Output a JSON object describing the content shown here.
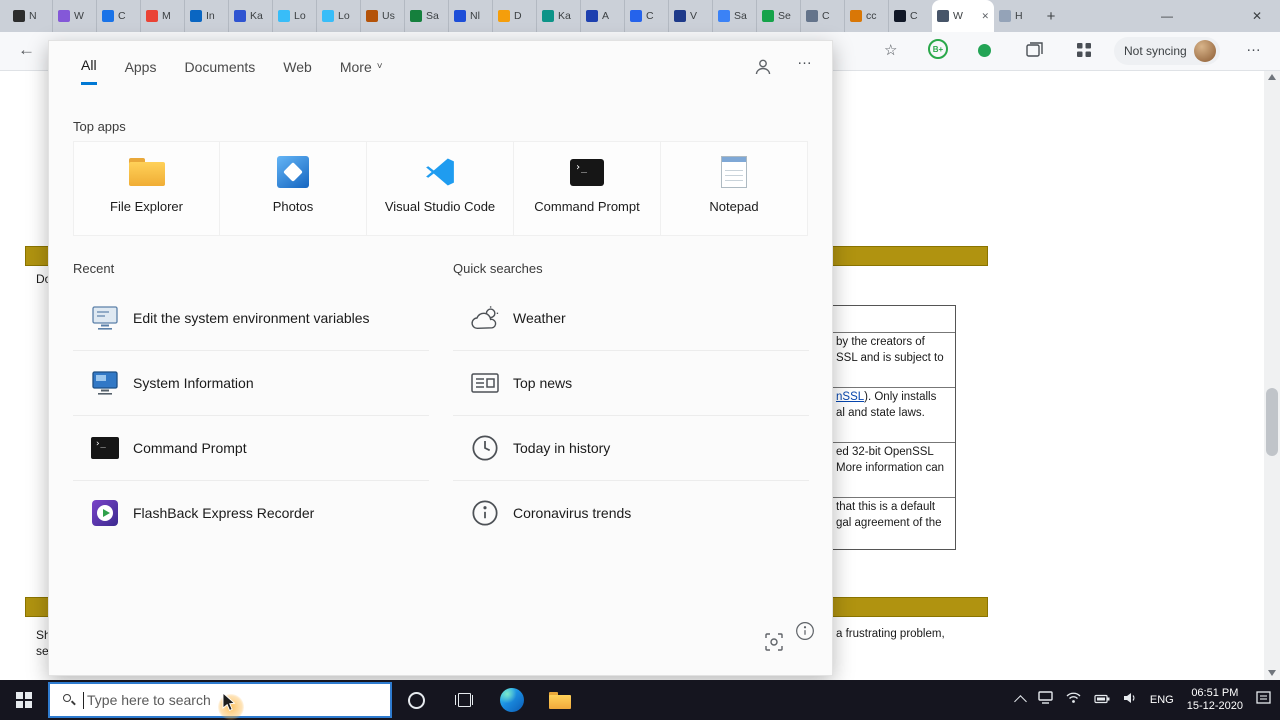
{
  "icons": {
    "minimize": "—",
    "close": "✕",
    "new_tab": "+",
    "back": "←",
    "favorites": "☆",
    "more": "…",
    "dropdown": "˅",
    "prompt": "›_"
  },
  "colors": {
    "gold_bar": "#b09310",
    "accent": "#0078d4",
    "taskbar_search_border": "#2f7cd0"
  },
  "browser": {
    "tabs": [
      {
        "label": "N",
        "color": "#2d2d2d"
      },
      {
        "label": "W",
        "color": "#8458d8"
      },
      {
        "label": "C",
        "color": "#1a73e8"
      },
      {
        "label": "M",
        "color": "#ea4335"
      },
      {
        "label": "In",
        "color": "#0a66c2"
      },
      {
        "label": "Ka",
        "color": "#2f54d1"
      },
      {
        "label": "Lo",
        "color": "#38bdf8"
      },
      {
        "label": "Lo",
        "color": "#38bdf8"
      },
      {
        "label": "Us",
        "color": "#b45309"
      },
      {
        "label": "Sa",
        "color": "#15803d"
      },
      {
        "label": "Nl",
        "color": "#1d4ed8"
      },
      {
        "label": "D",
        "color": "#f59e0b"
      },
      {
        "label": "Ka",
        "color": "#0d9488"
      },
      {
        "label": "A",
        "color": "#1e40af"
      },
      {
        "label": "C",
        "color": "#2563eb"
      },
      {
        "label": "V",
        "color": "#1e3a8a"
      },
      {
        "label": "Sa",
        "color": "#3b82f6"
      },
      {
        "label": "Se",
        "color": "#16a34a"
      },
      {
        "label": "C",
        "color": "#64748b"
      },
      {
        "label": "cc",
        "color": "#d97706"
      },
      {
        "label": "C",
        "color": "#111827"
      },
      {
        "label": "W",
        "color": "#475569"
      },
      {
        "label": "H",
        "color": "#94a3b8"
      }
    ],
    "toolbar": {
      "badge": "B+",
      "sync_label": "Not syncing"
    }
  },
  "search_panel": {
    "tabs": [
      {
        "label": "All"
      },
      {
        "label": "Apps"
      },
      {
        "label": "Documents"
      },
      {
        "label": "Web"
      },
      {
        "label": "More"
      }
    ],
    "top_apps": {
      "title": "Top apps",
      "apps": [
        {
          "name": "File Explorer"
        },
        {
          "name": "Photos"
        },
        {
          "name": "Visual Studio Code"
        },
        {
          "name": "Command Prompt"
        },
        {
          "name": "Notepad"
        }
      ]
    },
    "recent": {
      "title": "Recent",
      "items": [
        "Edit the system environment variables",
        "System Information",
        "Command Prompt",
        "FlashBack Express Recorder"
      ]
    },
    "quick_searches": {
      "title": "Quick searches",
      "items": [
        "Weather",
        "Top news",
        "Today in history",
        "Coronavirus trends"
      ]
    }
  },
  "taskbar": {
    "search_placeholder": "Type here to search",
    "tray": {
      "language": "ENG",
      "time": "06:51 PM",
      "date": "15-12-2020"
    }
  },
  "page": {
    "left_fragments": [
      "Do",
      "Sh",
      "se"
    ],
    "lines": [
      {
        "text": "by the creators of"
      },
      {
        "text": "SSL and is subject to"
      },
      {
        "link": "nSSL",
        "text": "). Only installs"
      },
      {
        "text": "al and state laws."
      },
      {
        "text": "ed 32-bit OpenSSL"
      },
      {
        "text": "More information can"
      },
      {
        "text": "that this is a default"
      },
      {
        "text": "gal agreement of the"
      }
    ],
    "bottom_line": "a frustrating problem,"
  }
}
